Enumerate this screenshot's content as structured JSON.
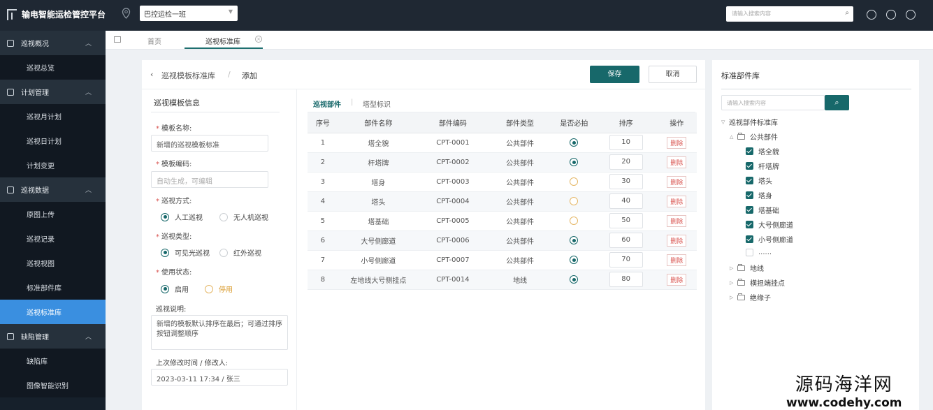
{
  "app": {
    "title": "输电智能运检管控平台"
  },
  "header": {
    "team_select": "巴控运检一班",
    "search_placeholder": "请输入搜索内容",
    "icons": [
      "settings-icon",
      "logout-icon",
      "user-icon"
    ]
  },
  "sidebar": {
    "groups": [
      {
        "label": "巡视概况",
        "icon": "home-icon",
        "items": [
          "巡视总览"
        ]
      },
      {
        "label": "计划管理",
        "icon": "grid-icon",
        "items": [
          "巡视月计划",
          "巡视日计划",
          "计划变更"
        ]
      },
      {
        "label": "巡视数据",
        "icon": "database-icon",
        "items": [
          "原图上传",
          "巡视记录",
          "巡视视图",
          "标准部件库",
          "巡视标准库"
        ]
      },
      {
        "label": "缺陷管理",
        "icon": "flag-icon",
        "items": [
          "缺陷库",
          "图像智能识别"
        ]
      }
    ],
    "active_item": "巡视标准库"
  },
  "tabs": [
    "首页",
    "巡视标准库"
  ],
  "breadcrumb": {
    "parent": "巡视模板标准库",
    "sep": "/",
    "current": "添加"
  },
  "actions": {
    "save": "保存",
    "cancel": "取消"
  },
  "form": {
    "section_title": "巡视模板信息",
    "name_label": "模板名称:",
    "name_value": "新增的巡视模板标准",
    "code_label": "模板编码:",
    "code_placeholder": "自动生成，可编辑",
    "mode_label": "巡视方式:",
    "mode_options": [
      "人工巡视",
      "无人机巡视"
    ],
    "mode_selected": "人工巡视",
    "type_label": "巡视类型:",
    "type_options": [
      "可见光巡视",
      "红外巡视"
    ],
    "type_selected": "可见光巡视",
    "status_label": "使用状态:",
    "status_options": [
      "启用",
      "停用"
    ],
    "status_selected": "启用",
    "desc_label": "巡视说明:",
    "desc_value": "新增的模板默认排序在最后；可通过排序按钮调整顺序",
    "modified_label": "上次修改时间 / 修改人:",
    "modified_value": "2023-03-11 17:34  /  张三"
  },
  "subtabs": [
    "巡视部件",
    "塔型标识"
  ],
  "table": {
    "headers": [
      "序号",
      "部件名称",
      "部件编码",
      "部件类型",
      "是否必拍",
      "排序",
      "操作"
    ],
    "delete_label": "删除",
    "rows": [
      {
        "no": "1",
        "name": "塔全貌",
        "code": "CPT-0001",
        "type": "公共部件",
        "required": true,
        "order": "10"
      },
      {
        "no": "2",
        "name": "杆塔牌",
        "code": "CPT-0002",
        "type": "公共部件",
        "required": true,
        "order": "20"
      },
      {
        "no": "3",
        "name": "塔身",
        "code": "CPT-0003",
        "type": "公共部件",
        "required": false,
        "order": "30"
      },
      {
        "no": "4",
        "name": "塔头",
        "code": "CPT-0004",
        "type": "公共部件",
        "required": false,
        "order": "40"
      },
      {
        "no": "5",
        "name": "塔基础",
        "code": "CPT-0005",
        "type": "公共部件",
        "required": false,
        "order": "50"
      },
      {
        "no": "6",
        "name": "大号侧廊道",
        "code": "CPT-0006",
        "type": "公共部件",
        "required": true,
        "order": "60"
      },
      {
        "no": "7",
        "name": "小号侧廊道",
        "code": "CPT-0007",
        "type": "公共部件",
        "required": true,
        "order": "70"
      },
      {
        "no": "8",
        "name": "左地线大号侧挂点",
        "code": "CPT-0014",
        "type": "地线",
        "required": true,
        "order": "80"
      }
    ]
  },
  "library": {
    "title": "标准部件库",
    "search_placeholder": "请输入搜索内容",
    "root": "巡视部件标准库",
    "public_group": "公共部件",
    "public_items": [
      "塔全貌",
      "杆塔牌",
      "塔头",
      "塔身",
      "塔基础",
      "大号侧廊道",
      "小号侧廊道"
    ],
    "more": "......",
    "other_groups": [
      "地线",
      "横担端挂点",
      "绝缘子"
    ]
  },
  "watermark": {
    "line1": "源码海洋网",
    "line2": "www.codehy.com"
  },
  "colors": {
    "primary": "#17686a",
    "sidebar_active": "#3a8fe0",
    "topbar": "#1f2833",
    "danger": "#d9534f"
  }
}
